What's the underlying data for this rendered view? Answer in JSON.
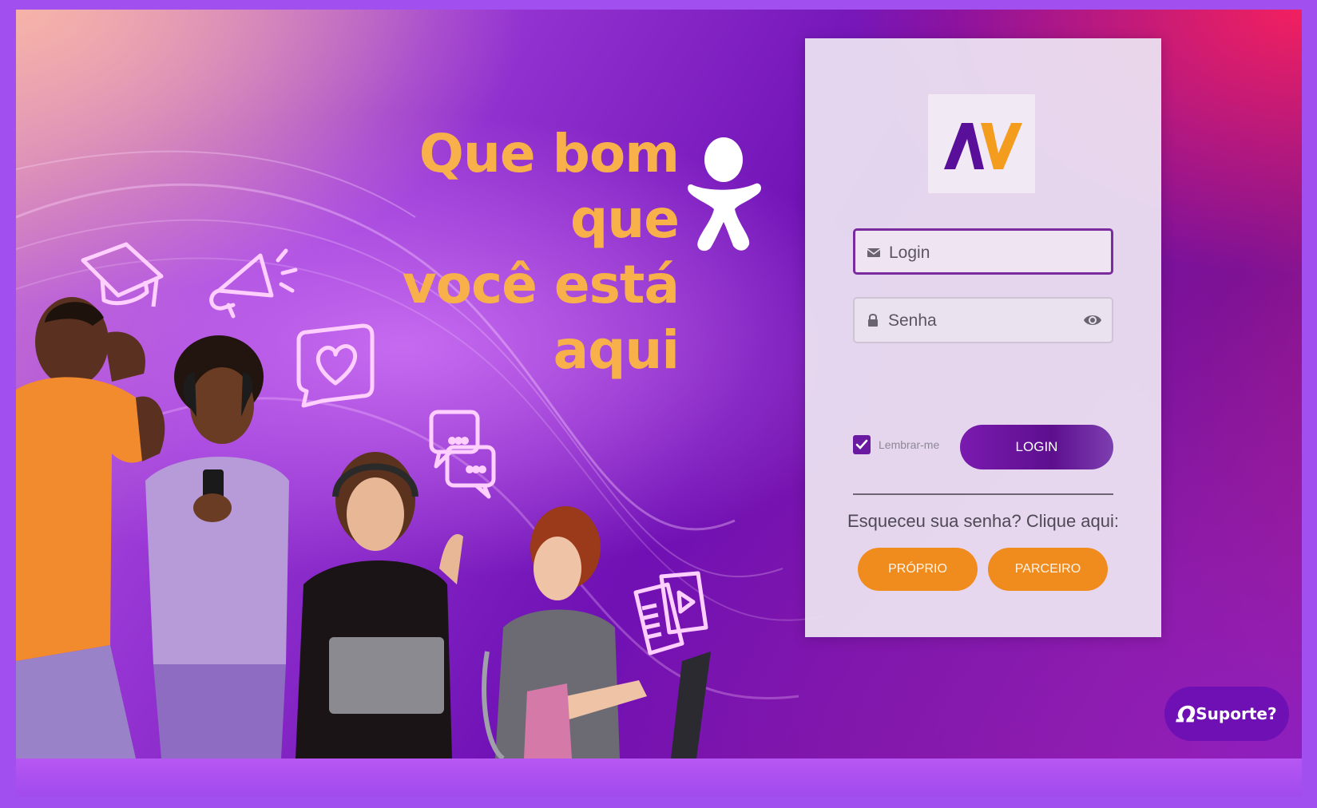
{
  "hero": {
    "headline_line1": "Que bom que",
    "headline_line2": "você está aqui"
  },
  "login_form": {
    "logo_text": "AV",
    "login_placeholder": "Login",
    "password_placeholder": "Senha",
    "remember_label": "Lembrar-me",
    "remember_checked": true,
    "login_button": "LOGIN",
    "forgot_text": "Esqueceu sua senha? Clique aqui:",
    "proprio_button": "PRÓPRIO",
    "parceiro_button": "PARCEIRO"
  },
  "support": {
    "label": "Suporte?"
  },
  "icons": {
    "email": "envelope-icon",
    "password": "lock-icon",
    "show_password": "eye-icon",
    "support": "chat-bubble-icon",
    "neon_decorations": [
      "graduation-cap-icon",
      "megaphone-icon",
      "heart-chat-icon",
      "chat-bubbles-icon",
      "video-document-icon"
    ]
  },
  "colors": {
    "headline": "#f7b04a",
    "primary_purple": "#6a1aa0",
    "orange_buttons": "#f08c1e",
    "logo_purple": "#5a0f9a",
    "logo_orange": "#f39c1e"
  }
}
